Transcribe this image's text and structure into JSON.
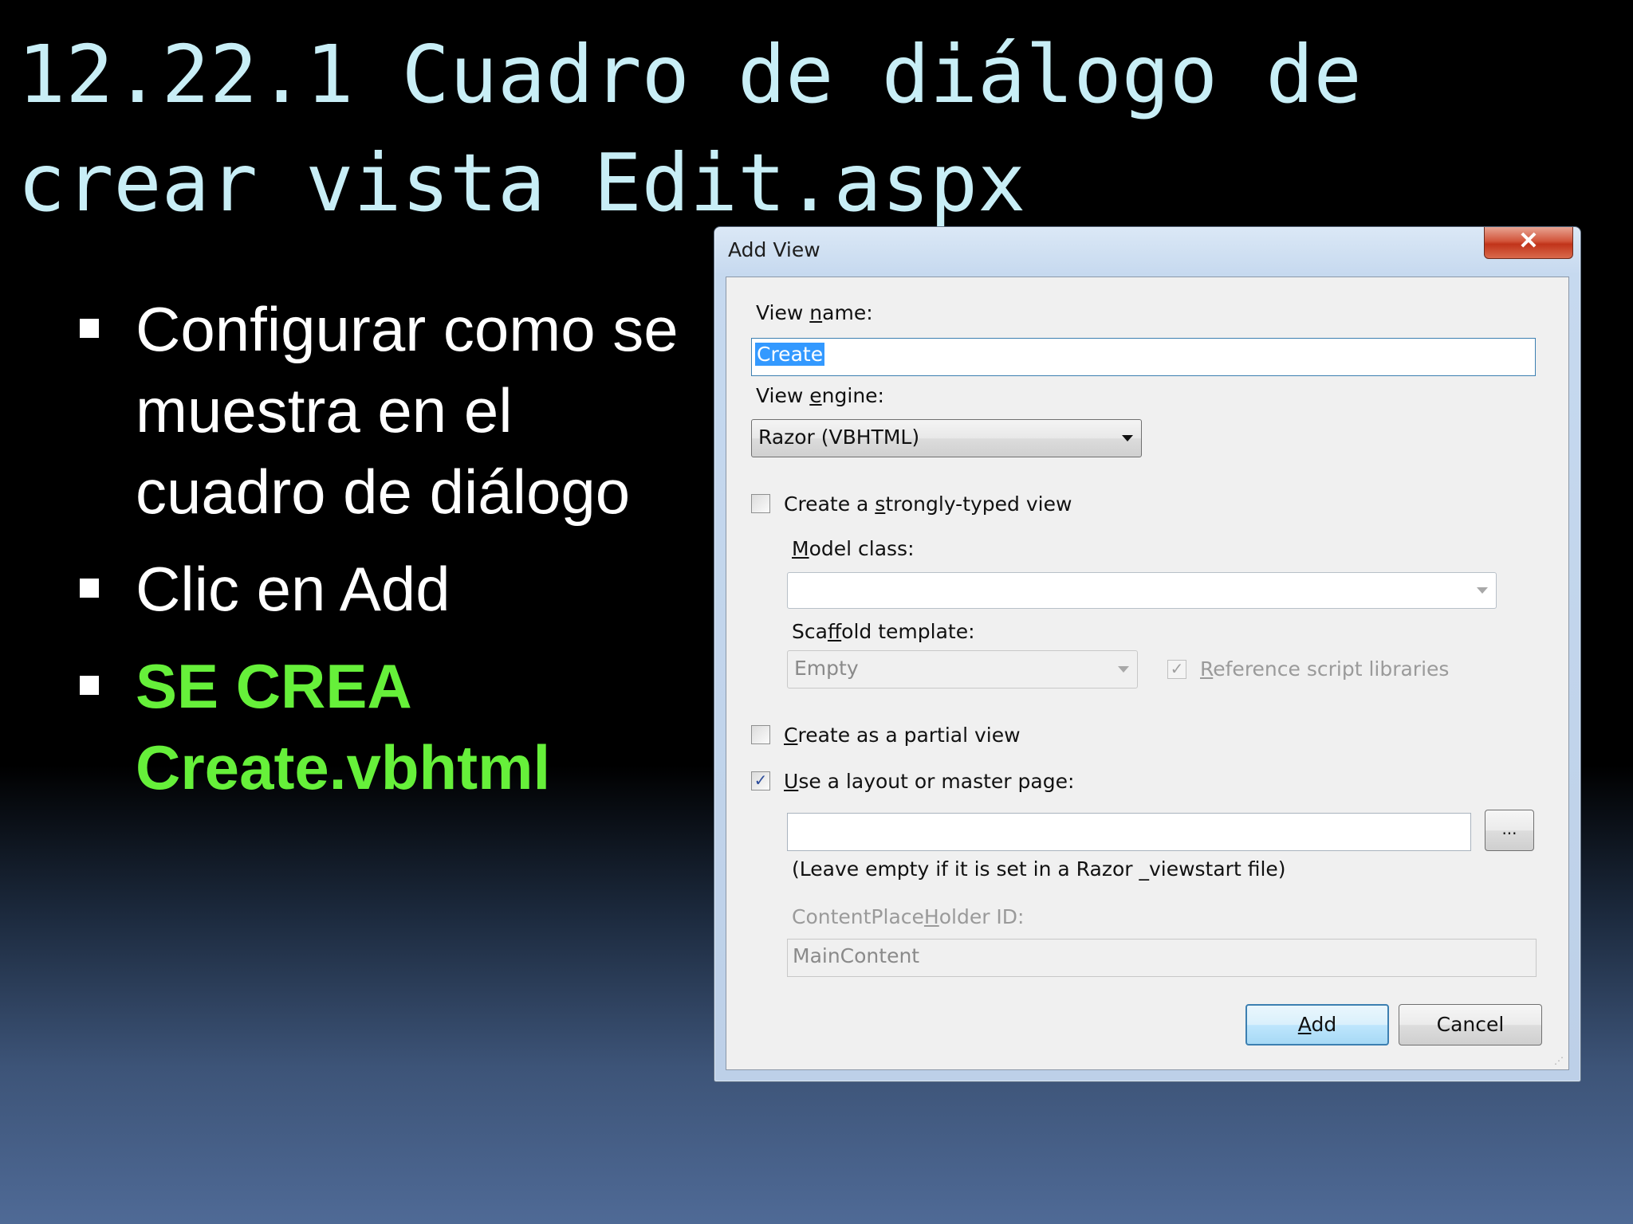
{
  "slide": {
    "title": "12.22.1 Cuadro de diálogo de crear vista Edit.aspx",
    "bullets": [
      "Configurar como se muestra en el cuadro de diálogo",
      "Clic en Add",
      "SE CREA Create.vbhtml"
    ]
  },
  "dialog": {
    "title": "Add View",
    "close_glyph": "✕",
    "view_name_label_pre": "View ",
    "view_name_label_u": "n",
    "view_name_label_post": "ame:",
    "view_name_value": "Create",
    "view_engine_label_pre": "View ",
    "view_engine_label_u": "e",
    "view_engine_label_post": "ngine:",
    "view_engine_value": "Razor (VBHTML)",
    "strongly_typed_pre": "Create a ",
    "strongly_typed_u": "s",
    "strongly_typed_post": "trongly-typed view",
    "model_class_u": "M",
    "model_class_post": "odel class:",
    "model_class_value": "",
    "scaffold_pre": "Sca",
    "scaffold_u": "f",
    "scaffold_post": "fold template:",
    "scaffold_value": "Empty",
    "reference_u": "R",
    "reference_post": "eference script libraries",
    "partial_u": "C",
    "partial_post": "reate as a partial view",
    "layout_u": "U",
    "layout_post": "se a layout or master page:",
    "layout_value": "",
    "browse_label": "...",
    "layout_hint": "(Leave empty if it is set in a Razor _viewstart file)",
    "placeholder_pre": "ContentPlace",
    "placeholder_u": "H",
    "placeholder_post": "older ID:",
    "placeholder_value": "MainContent",
    "add_u": "A",
    "add_post": "dd",
    "cancel_label": "Cancel",
    "check_glyph": "✓",
    "checkboxes": {
      "strongly_typed": false,
      "reference_scripts": true,
      "partial_view": false,
      "use_layout": true
    }
  }
}
